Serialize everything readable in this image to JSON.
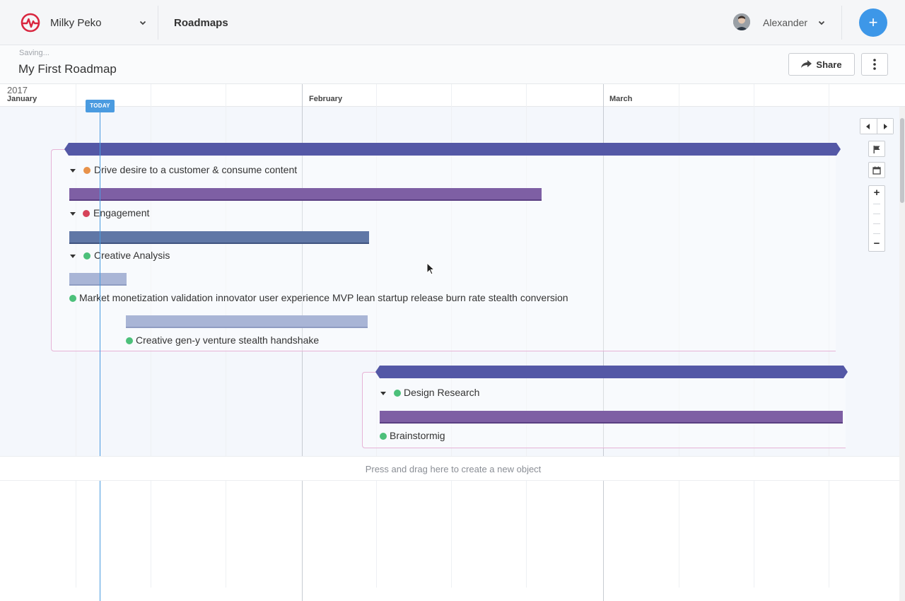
{
  "header": {
    "workspace_name": "Milky Peko",
    "section_title": "Roadmaps",
    "user_name": "Alexander",
    "add_label": "+"
  },
  "roadmap": {
    "saving_status": "Saving...",
    "title": "My First Roadmap",
    "share_label": "Share"
  },
  "timeline": {
    "year": "2017",
    "months": [
      "January",
      "February",
      "March"
    ],
    "today_label": "TODAY"
  },
  "items": {
    "drive_desire": "Drive desire to a customer & consume content",
    "engagement": "Engagement",
    "creative_analysis": "Creative Analysis",
    "market_monetization": "Market monetization validation innovator user experience MVP lean startup release burn rate stealth conversion",
    "creative_geny": "Creative gen-y venture stealth handshake",
    "design_research": "Design Research",
    "brainstorming": "Brainstormig"
  },
  "canvas": {
    "create_hint": "Press and drag here to create a new object"
  },
  "colors": {
    "accent_blue": "#3d97e8",
    "initiative_bar": "#5458a6",
    "purple_bar": "#7e5fa4",
    "slate_bar": "#6077a6",
    "light_bar": "#a9b5d6",
    "dot_orange": "#e8924a",
    "dot_red": "#d6435a",
    "dot_green": "#4cc07a"
  }
}
